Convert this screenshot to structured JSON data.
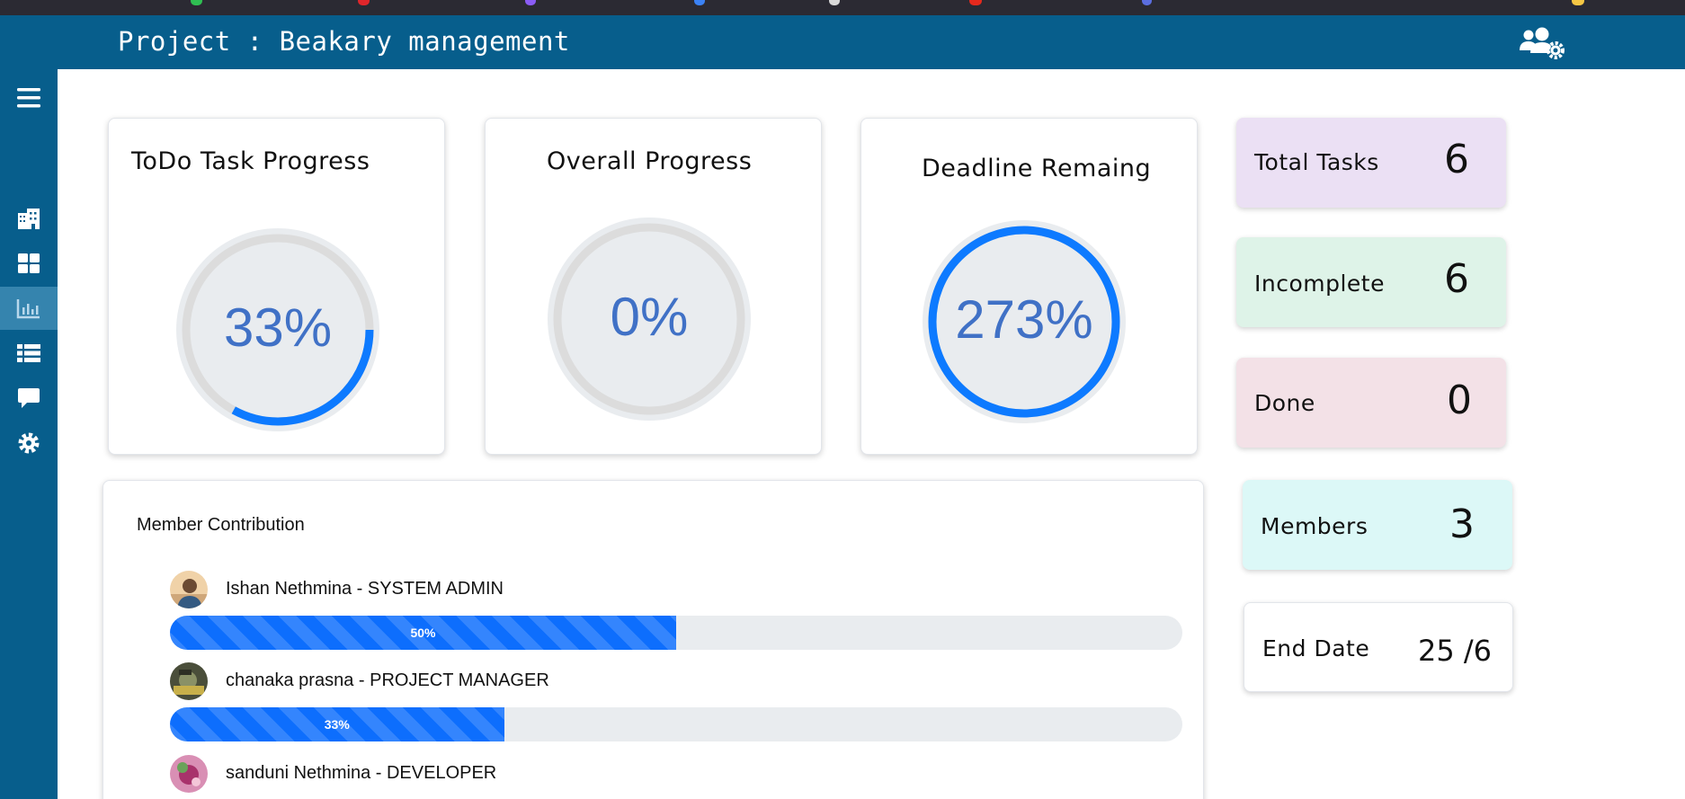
{
  "header": {
    "title": "Project : Beakary management"
  },
  "colors": {
    "brand": "#075e8c",
    "ring": "#0d7aff",
    "ring_text": "#4071c6"
  },
  "icons": {
    "header_right": "users-gear-icon",
    "sidebar": [
      "hamburger-menu-icon",
      "building-icon",
      "grid-dashboard-icon",
      "chart-bar-icon",
      "list-table-icon",
      "comment-icon",
      "gear-icon"
    ]
  },
  "progress_cards": [
    {
      "title": "ToDo Task Progress",
      "label": "33%",
      "value": 33
    },
    {
      "title": "Overall Progress",
      "label": "0%",
      "value": 0
    },
    {
      "title": "Deadline Remaing",
      "label": "273%",
      "value": 273
    }
  ],
  "stats": {
    "total_tasks": {
      "label": "Total Tasks",
      "value": "6",
      "color": "#ebe0f4"
    },
    "incomplete": {
      "label": "Incomplete",
      "value": "6",
      "color": "#def3e8"
    },
    "done": {
      "label": "Done",
      "value": "0",
      "color": "#f3e1e7"
    },
    "members": {
      "label": "Members",
      "value": "3",
      "color": "#dcf8f7"
    },
    "end_date": {
      "label": "End Date",
      "value": "25 /6",
      "color": "#ffffff"
    }
  },
  "contribution": {
    "title": "Member Contribution",
    "members": [
      {
        "name": "Ishan Nethmina - SYSTEM ADMIN",
        "percent_label": "50%",
        "percent": 50
      },
      {
        "name": "chanaka prasna - PROJECT MANAGER",
        "percent_label": "33%",
        "percent": 33
      },
      {
        "name": "sanduni Nethmina - DEVELOPER"
      }
    ]
  }
}
